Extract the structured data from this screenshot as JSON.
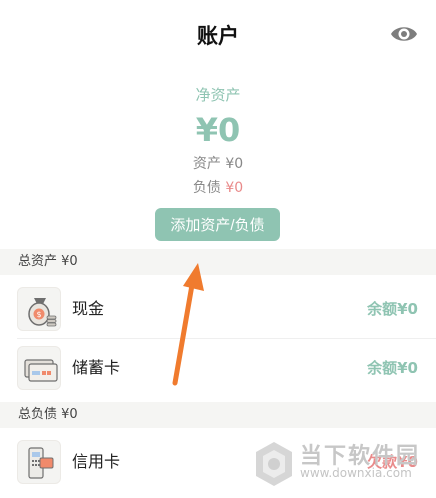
{
  "header": {
    "title": "账户",
    "eye_icon": "eye-icon"
  },
  "summary": {
    "net_label": "净资产",
    "net_value": "¥0",
    "assets_label": "资产",
    "assets_value": "¥0",
    "liabilities_label": "负债",
    "liabilities_value": "¥0"
  },
  "add_button": {
    "label": "添加资产/负债"
  },
  "assets_section": {
    "title": "总资产 ¥0",
    "items": [
      {
        "name": "现金",
        "balance": "余额¥0",
        "icon": "money-bag-icon"
      },
      {
        "name": "储蓄卡",
        "balance": "余额¥0",
        "icon": "debit-card-icon"
      }
    ]
  },
  "liabilities_section": {
    "title": "总负债 ¥0",
    "items": [
      {
        "name": "信用卡",
        "balance": "欠款¥0",
        "icon": "credit-card-reader-icon"
      }
    ]
  },
  "watermark": {
    "text": "当下软件园",
    "url": "www.downxia.com"
  },
  "colors": {
    "accent": "#8fc4b2",
    "debt": "#e98a8a",
    "section_bg": "#f5f5f3",
    "arrow": "#f07b2e"
  }
}
